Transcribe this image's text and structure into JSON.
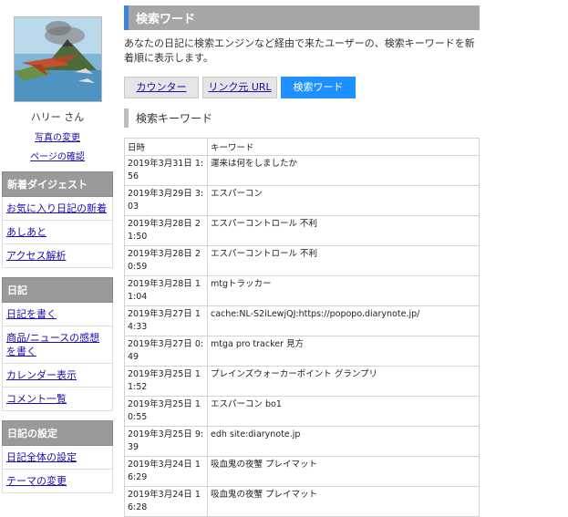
{
  "sidebar": {
    "user_name": "ハリー さん",
    "photo_link": "写真の変更",
    "page_check_link": "ページの確認",
    "sections": [
      {
        "header": "新着ダイジェスト",
        "items": [
          "お気に入り日記の新着",
          "あしあと",
          "アクセス解析"
        ]
      },
      {
        "header": "日記",
        "items": [
          "日記を書く",
          "商品/ニュースの感想を書く",
          "カレンダー表示",
          "コメント一覧"
        ]
      },
      {
        "header": "日記の設定",
        "items": [
          "日記全体の設定",
          "テーマの変更"
        ]
      }
    ]
  },
  "main": {
    "title": "検索ワード",
    "description": "あなたの日記に検索エンジンなど経由で来たユーザーの、検索キーワードを新着順に表示します。",
    "tabs": [
      {
        "label": "カウンター",
        "active": false
      },
      {
        "label": "リンク元 URL",
        "active": false
      },
      {
        "label": "検索ワード",
        "active": true
      }
    ],
    "section_title": "検索キーワード",
    "table": {
      "headers": [
        "日時",
        "キーワード"
      ],
      "rows": [
        {
          "date": "2019年3月31日 1:56",
          "keyword": "運来は何をしましたか"
        },
        {
          "date": "2019年3月29日 3:03",
          "keyword": "エスパーコン"
        },
        {
          "date": "2019年3月28日 21:50",
          "keyword": "エスパーコントロール 不利"
        },
        {
          "date": "2019年3月28日 20:59",
          "keyword": "エスパーコントロール 不利"
        },
        {
          "date": "2019年3月28日 11:04",
          "keyword": "mtgトラッカー"
        },
        {
          "date": "2019年3月27日 14:33",
          "keyword": "cache:NL-S2iLewjQJ:https://popopo.diarynote.jp/"
        },
        {
          "date": "2019年3月27日 0:49",
          "keyword": "mtga pro tracker 見方"
        },
        {
          "date": "2019年3月25日 11:52",
          "keyword": "プレインズウォーカーポイント グランプリ"
        },
        {
          "date": "2019年3月25日 10:55",
          "keyword": "エスパーコン bo1"
        },
        {
          "date": "2019年3月25日 9:39",
          "keyword": "edh site:diarynote.jp"
        },
        {
          "date": "2019年3月24日 16:29",
          "keyword": "吸血鬼の夜蟹 プレイマット"
        },
        {
          "date": "2019年3月24日 16:28",
          "keyword": "吸血鬼の夜蟹 プレイマット"
        }
      ]
    }
  },
  "colors": {
    "accent": "#1e90ff",
    "header_gray": "#a6a6a6",
    "link": "#1a0dab"
  }
}
